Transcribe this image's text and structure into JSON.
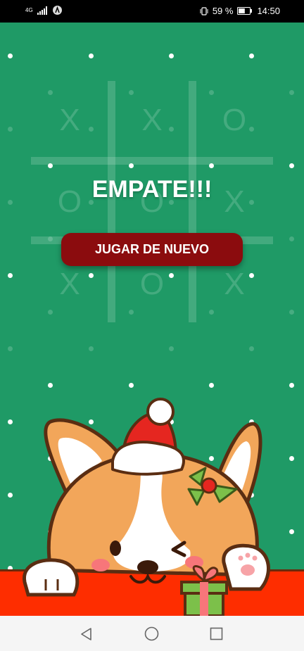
{
  "status_bar": {
    "network": "4G",
    "battery_percent": "59 %",
    "time": "14:50",
    "battery_level": 0.59
  },
  "board": {
    "cells": [
      "X",
      "X",
      "O",
      "O",
      "O",
      "X",
      "X",
      "O",
      "X"
    ]
  },
  "result": {
    "text": "EMPATE!!!"
  },
  "replay_button": {
    "label": "JUGAR DE NUEVO"
  },
  "colors": {
    "background": "#1f9a66",
    "button": "#8b0c0e",
    "floor": "#fe2d00"
  },
  "icons": [
    "signal-icon",
    "app-icon",
    "vibrate-icon",
    "battery-icon",
    "back-icon",
    "home-icon",
    "recents-icon",
    "corgi-illustration",
    "gift-icon"
  ]
}
